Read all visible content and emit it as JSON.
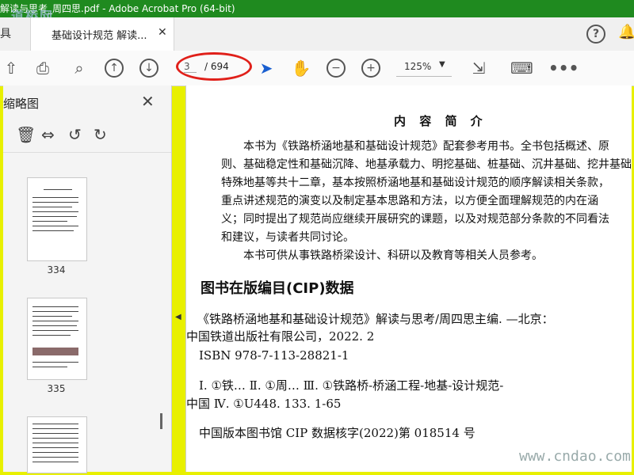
{
  "window": {
    "title": "解读与思考_周四思.pdf - Adobe Acrobat Pro (64-bit)",
    "watermark_top": "道桥网"
  },
  "tabs": {
    "left_partial": "具",
    "active_label": "基础设计规范 解读...",
    "close": "✕"
  },
  "toolbar": {
    "current_page": "3",
    "total_pages": "/ 694",
    "zoom": "125%"
  },
  "sidepanel": {
    "title": "缩略图",
    "pages": [
      "334",
      "335"
    ]
  },
  "document": {
    "heading": "内 容 简 介",
    "summary_lines": [
      "本书为《铁路桥涵地基和基础设计规范》配套参考用书。全书包括概述、原",
      "则、基础稳定性和基础沉降、地基承载力、明挖基础、桩基础、沉井基础、挖井基础、",
      "特殊地基等共十二章，基本按照桥涵地基和基础设计规范的顺序解读相关条款，",
      "重点讲述规范的演变以及制定基本思路和方法，以方便全面理解规范的内在涵",
      "义；同时提出了规范尚应继续开展研究的课题，以及对规范部分条款的不同看法",
      "和建议，与读者共同讨论。",
      "本书可供从事铁路桥梁设计、科研以及教育等相关人员参考。"
    ],
    "cip_title": "图书在版编目(CIP)数据",
    "cip_lines": [
      "《铁路桥涵地基和基础设计规范》解读与思考/周四思主编. —北京：",
      "中国铁道出版社有限公司，2022. 2",
      "ISBN 978-7-113-28821-1",
      "Ⅰ. ①铁…  Ⅱ. ①周…  Ⅲ. ①铁路桥-桥涵工程-地基-设计规范-",
      "中国  Ⅳ. ①U448. 133. 1-65",
      "中国版本图书馆 CIP 数据核字(2022)第 018514 号"
    ]
  },
  "watermark_bottom": "www.cndao.com"
}
